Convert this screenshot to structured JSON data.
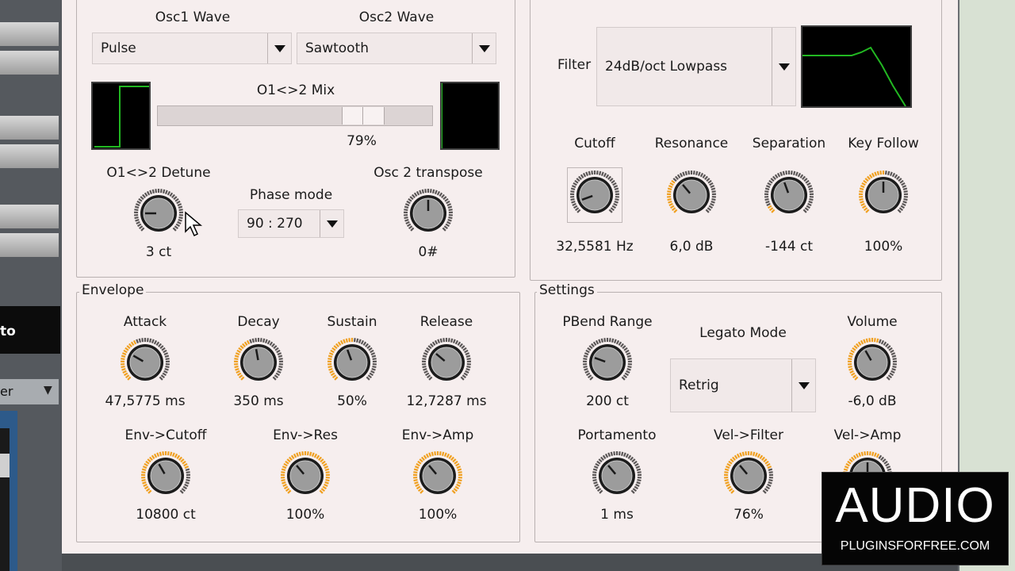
{
  "osc": {
    "osc1_wave_label": "Osc1 Wave",
    "osc1_wave_value": "Pulse",
    "osc2_wave_label": "Osc2 Wave",
    "osc2_wave_value": "Sawtooth",
    "mix_label": "O1<>2 Mix",
    "mix_value": "79%",
    "mix_fraction": 0.79,
    "detune_label": "O1<>2 Detune",
    "detune_value": "3 ct",
    "phase_label": "Phase mode",
    "phase_value": "90 : 270",
    "transpose_label": "Osc 2 transpose",
    "transpose_value": "0#"
  },
  "filter": {
    "label": "Filter",
    "type_value": "24dB/oct Lowpass",
    "cutoff_label": "Cutoff",
    "cutoff_value": "32,5581 Hz",
    "resonance_label": "Resonance",
    "resonance_value": "6,0 dB",
    "separation_label": "Separation",
    "separation_value": "-144 ct",
    "keyfollow_label": "Key Follow",
    "keyfollow_value": "100%"
  },
  "envelope": {
    "title": "Envelope",
    "attack_label": "Attack",
    "attack_value": "47,5775 ms",
    "decay_label": "Decay",
    "decay_value": "350 ms",
    "sustain_label": "Sustain",
    "sustain_value": "50%",
    "release_label": "Release",
    "release_value": "12,7287 ms",
    "env_cutoff_label": "Env->Cutoff",
    "env_cutoff_value": "10800 ct",
    "env_res_label": "Env->Res",
    "env_res_value": "100%",
    "env_amp_label": "Env->Amp",
    "env_amp_value": "100%"
  },
  "settings": {
    "title": "Settings",
    "pbend_label": "PBend Range",
    "pbend_value": "200 ct",
    "legato_label": "Legato Mode",
    "legato_value": "Retrig",
    "volume_label": "Volume",
    "volume_value": "-6,0 dB",
    "portamento_label": "Portamento",
    "portamento_value": "1 ms",
    "vel_filter_label": "Vel->Filter",
    "vel_filter_value": "76%",
    "vel_amp_label": "Vel->Amp"
  },
  "host": {
    "left_label_1": "to",
    "left_label_2": "er"
  },
  "watermark": {
    "big": "AUDIO",
    "small": "PLUGINSFORFREE.COM"
  },
  "colors": {
    "panel_bg": "#f6eeee",
    "knob_arc": "#f0a020",
    "scope_trace": "#22b822"
  }
}
